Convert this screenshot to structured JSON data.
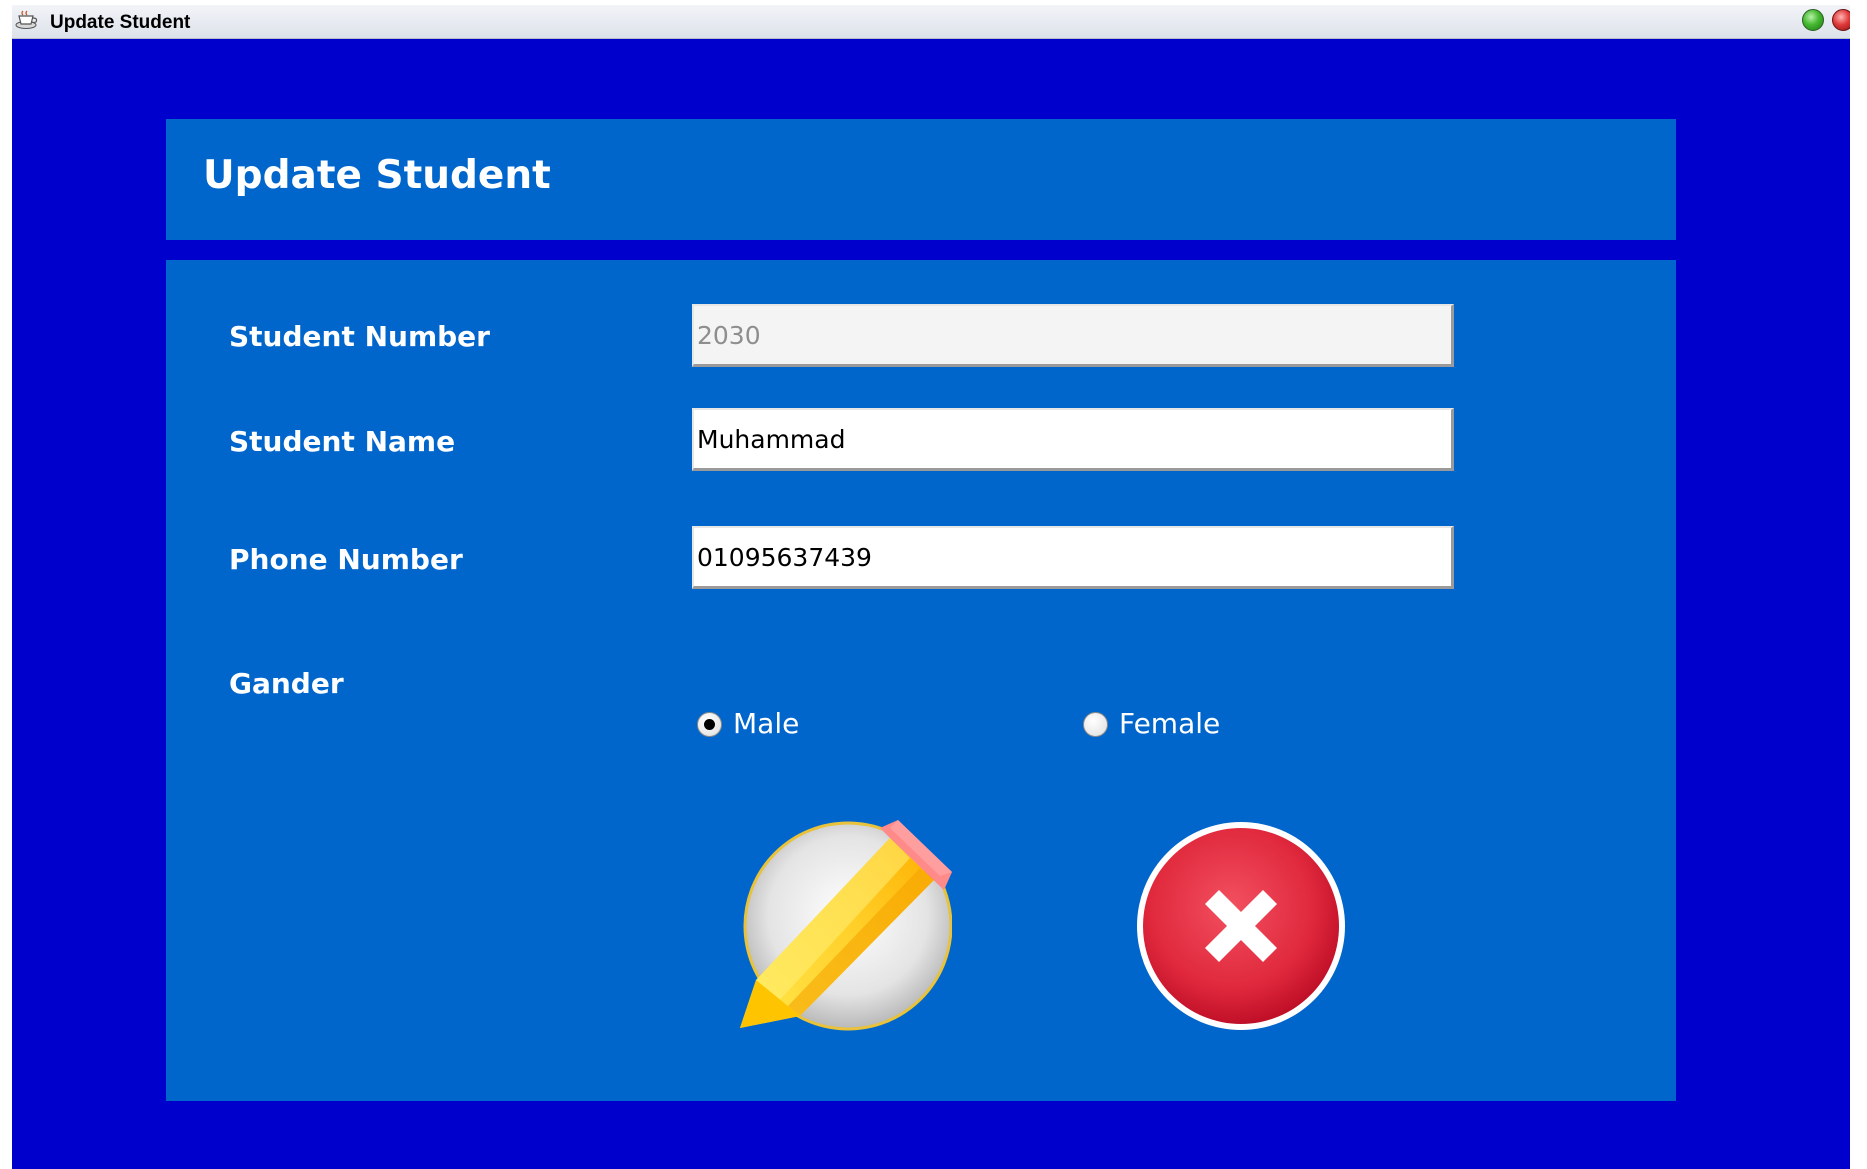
{
  "window": {
    "title": "Update Student"
  },
  "header": {
    "title": "Update Student"
  },
  "form": {
    "student_number": {
      "label": "Student Number",
      "value": "2030",
      "disabled": true
    },
    "student_name": {
      "label": "Student Name",
      "value": "Muhammad"
    },
    "phone_number": {
      "label": "Phone Number",
      "value": "01095637439"
    },
    "gender": {
      "label": "Gander",
      "options": [
        {
          "label": "Male",
          "selected": true
        },
        {
          "label": "Female",
          "selected": false
        }
      ]
    }
  },
  "actions": {
    "update_icon": "pencil-icon",
    "cancel_icon": "close-x-icon"
  },
  "colors": {
    "window_background": "#0000cd",
    "panel_background": "#0066cc",
    "text": "#ffffff",
    "cancel_red": "#e0283c",
    "pencil_yellow": "#ffd23c"
  }
}
